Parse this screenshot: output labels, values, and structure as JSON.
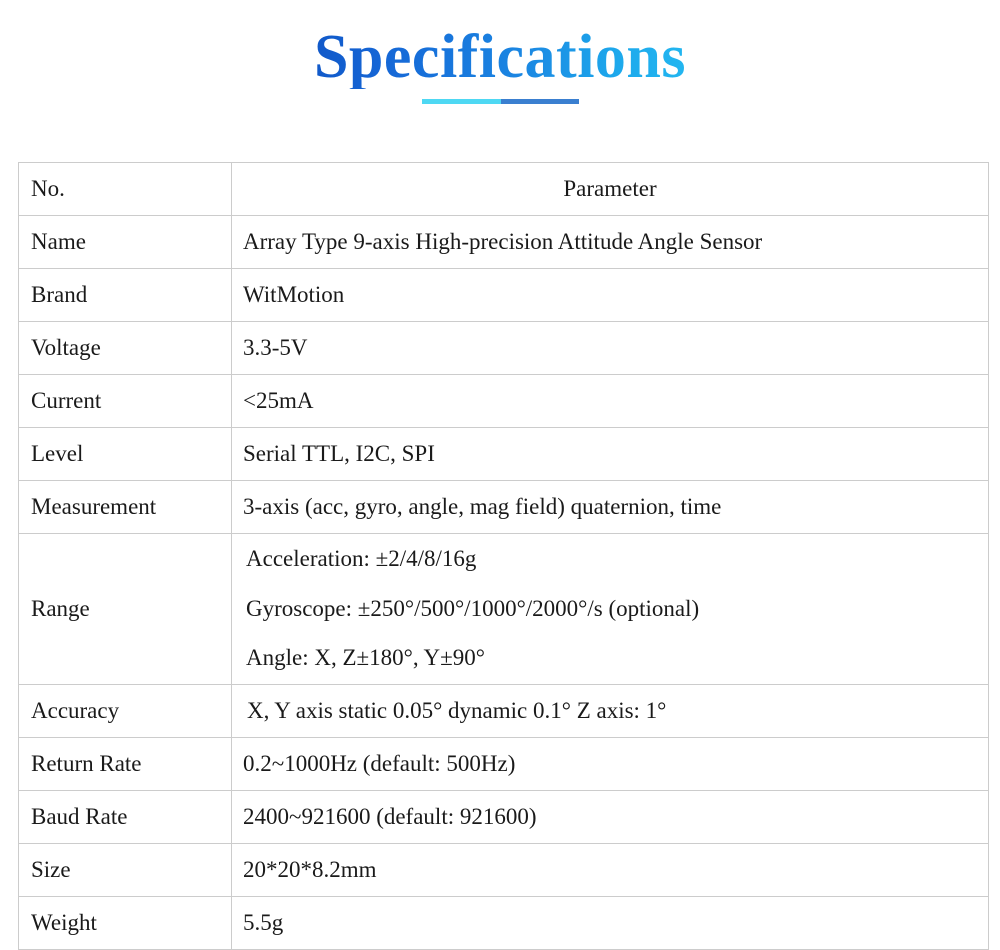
{
  "header": {
    "title": "Specifications",
    "title_gradient_from": "#1159C9",
    "title_gradient_to": "#22B6F0",
    "underline_left_color": "#4ED8F3",
    "underline_right_color": "#3A7FD0"
  },
  "table": {
    "columns": [
      "No.",
      "Parameter"
    ],
    "border_color": "#cccccc",
    "rows": [
      {
        "label": "Name",
        "value": "Array Type 9-axis High-precision Attitude Angle Sensor"
      },
      {
        "label": "Brand",
        "value": "WitMotion"
      },
      {
        "label": "Voltage",
        "value": "3.3-5V"
      },
      {
        "label": "Current",
        "value": "<25mA"
      },
      {
        "label": "Level",
        "value": "Serial TTL, I2C, SPI"
      },
      {
        "label": "Measurement",
        "value": "3-axis (acc, gyro, angle, mag field) quaternion, time"
      },
      {
        "label": "Range",
        "lines": [
          "Acceleration: ±2/4/8/16g",
          "Gyroscope: ±250°/500°/1000°/2000°/s (optional)",
          "Angle: X, Z±180°, Y±90°"
        ]
      },
      {
        "label": "Accuracy",
        "value": "X, Y axis static 0.05° dynamic 0.1° Z axis: 1°"
      },
      {
        "label": "Return Rate",
        "value": "0.2~1000Hz (default: 500Hz)"
      },
      {
        "label": "Baud Rate",
        "value": "2400~921600 (default: 921600)"
      },
      {
        "label": "Size",
        "value": "20*20*8.2mm"
      },
      {
        "label": "Weight",
        "value": "5.5g"
      }
    ]
  }
}
